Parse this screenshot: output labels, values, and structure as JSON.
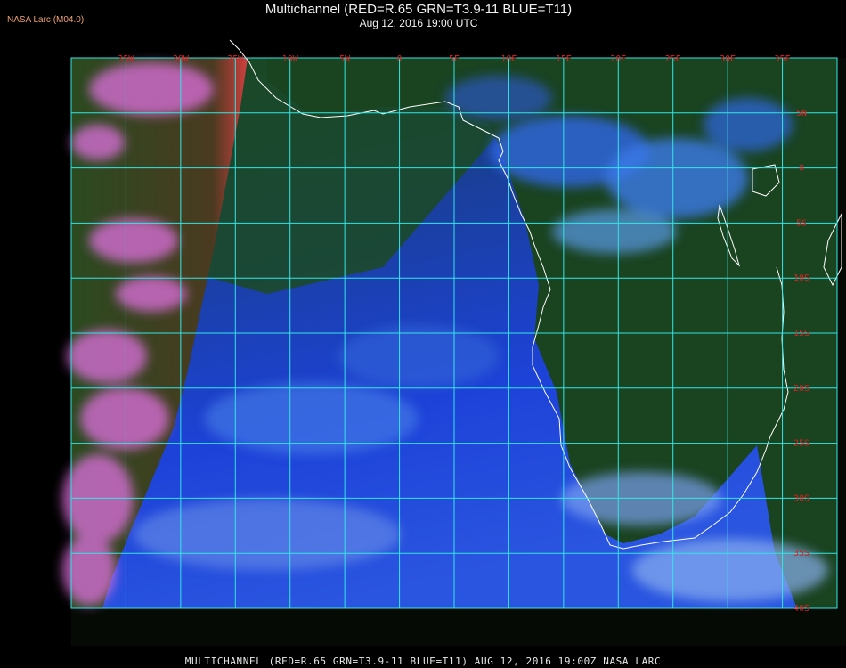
{
  "header": {
    "title": "Multichannel (RED=R.65 GRN=T3.9-11 BLUE=T11)",
    "subtitle": "Aug 12, 2016 19:00 UTC",
    "logo": "NASA Larc (M04.0)"
  },
  "map": {
    "lon_labels": [
      "35W",
      "30W",
      "25W",
      "10W",
      "5W",
      "0",
      "5E",
      "10E",
      "15E",
      "20E",
      "25E",
      "30E",
      "35E"
    ],
    "lat_labels": [
      "5N",
      "0",
      "5S",
      "10S",
      "15S",
      "20S",
      "25S",
      "30S",
      "35S",
      "40S"
    ],
    "colors": {
      "grid": "#33e6e6",
      "grid_label": "#e02020",
      "coastline": "#ffffff",
      "land": "#1f4a1f",
      "ocean": "#1b3fd0",
      "cloud": "#4a8cf0",
      "low_cloud": "#e070e0"
    }
  },
  "footer": {
    "caption": "MULTICHANNEL (RED=R.65 GRN=T3.9-11 BLUE=T11) AUG 12, 2016 19:00Z  NASA LARC"
  }
}
